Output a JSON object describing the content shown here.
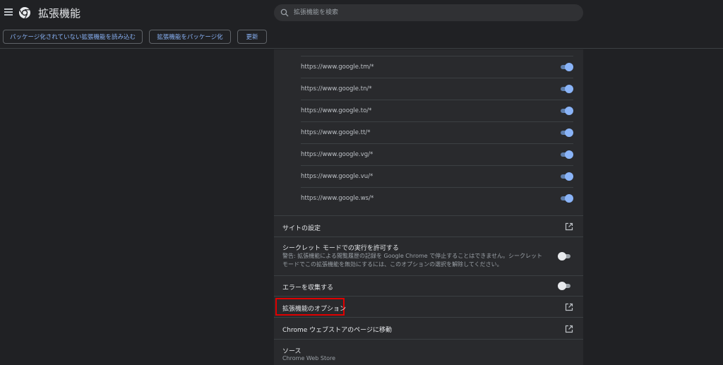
{
  "header": {
    "title": "拡張機能",
    "search_placeholder": "拡張機能を検索"
  },
  "toolbar": {
    "load_unpacked": "パッケージ化されていない拡張機能を読み込む",
    "pack_extension": "拡張機能をパッケージ化",
    "update": "更新"
  },
  "sites": [
    "https://www.google.tm/*",
    "https://www.google.tn/*",
    "https://www.google.to/*",
    "https://www.google.tt/*",
    "https://www.google.vg/*",
    "https://www.google.vu/*",
    "https://www.google.ws/*"
  ],
  "settings": {
    "site_settings": "サイトの設定",
    "incognito_title": "シークレット モードでの実行を許可する",
    "incognito_line1": "警告: 拡張機能による閲覧履歴の記録を Google Chrome で停止することはできません。シークレット",
    "incognito_line2": "モードでこの拡張機能を無効にするには、このオプションの選択を解除してください。",
    "incognito_enabled": false,
    "collect_errors": "エラーを収集する",
    "collect_errors_enabled": false,
    "extension_options": "拡張機能のオプション",
    "web_store_link": "Chrome ウェブストアのページに移動",
    "source_title": "ソース",
    "source_value": "Chrome Web Store"
  },
  "colors": {
    "accent": "#8ab4f8",
    "highlight": "#e00000",
    "background": "#202124",
    "card": "#292a2d"
  }
}
